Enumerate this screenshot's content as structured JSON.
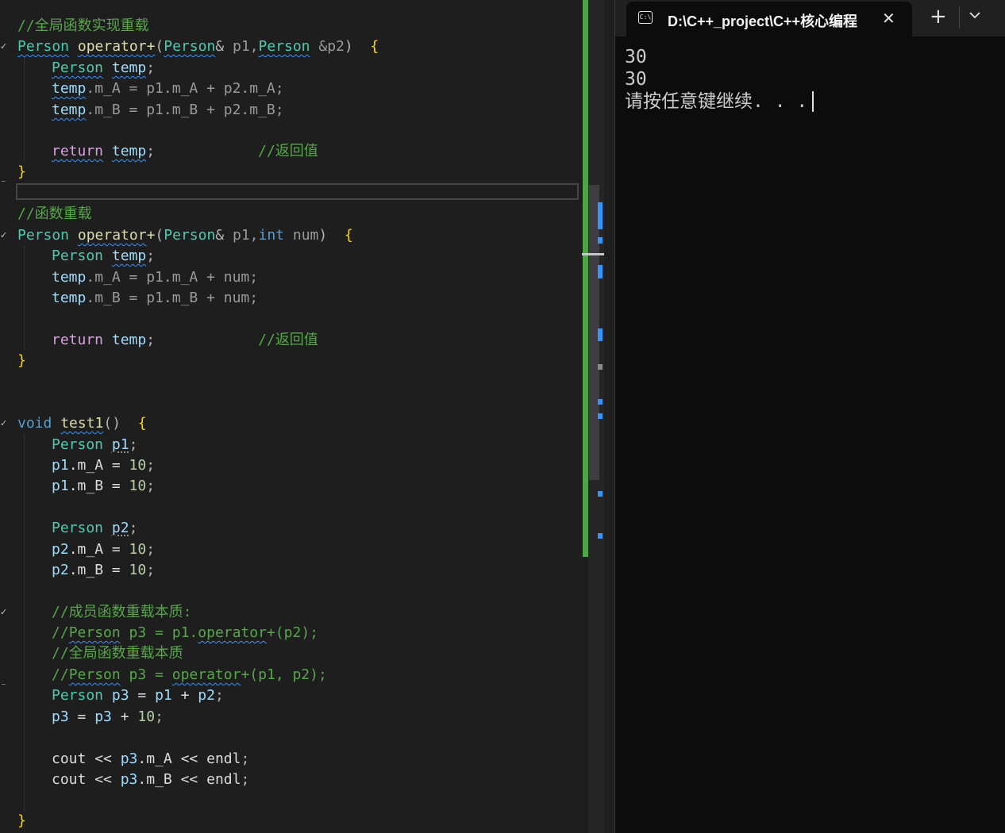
{
  "editor": {
    "lines": [
      {
        "t": 20,
        "i": 0,
        "toks": [
          [
            "//全局函数实现重载",
            "comment"
          ]
        ]
      },
      {
        "t": 46,
        "i": 0,
        "toks": [
          [
            "Person",
            "type",
            "sq"
          ],
          [
            " ",
            "text"
          ],
          [
            "operator+",
            "func",
            "sq"
          ],
          [
            "(",
            "punct"
          ],
          [
            "Person",
            "type",
            "sq"
          ],
          [
            "&",
            "punct"
          ],
          [
            " p1,",
            "param"
          ],
          [
            "Person",
            "type",
            "sq"
          ],
          [
            " &p2",
            "param"
          ],
          [
            ")",
            "punct"
          ],
          [
            "  ",
            "text"
          ],
          [
            "{",
            "brace1"
          ]
        ]
      },
      {
        "t": 73,
        "i": 1,
        "toks": [
          [
            "Person",
            "type",
            "sq"
          ],
          [
            " ",
            "text"
          ],
          [
            "temp",
            "ident",
            "sq"
          ],
          [
            ";",
            "punct"
          ]
        ]
      },
      {
        "t": 99,
        "i": 1,
        "toks": [
          [
            "temp",
            "ident",
            "sq"
          ],
          [
            ".m_A = p1.m_A + p2.m_A;",
            "param"
          ]
        ]
      },
      {
        "t": 126,
        "i": 1,
        "toks": [
          [
            "temp",
            "ident",
            "sq"
          ],
          [
            ".m_B = p1.m_B + p2.m_B;",
            "param"
          ]
        ]
      },
      {
        "t": 178,
        "i": 1,
        "toks": [
          [
            "return",
            "ctl",
            "sq"
          ],
          [
            " ",
            "text"
          ],
          [
            "temp",
            "ident",
            "sq"
          ],
          [
            ";",
            "punct"
          ],
          [
            "            ",
            "text"
          ],
          [
            "//返回值",
            "comment"
          ]
        ]
      },
      {
        "t": 204,
        "i": 0,
        "toks": [
          [
            "}",
            "brace1"
          ]
        ]
      },
      {
        "t": 257,
        "i": 0,
        "toks": [
          [
            "//函数重载",
            "comment"
          ]
        ]
      },
      {
        "t": 284,
        "i": 0,
        "toks": [
          [
            "Person",
            "type"
          ],
          [
            " ",
            "text"
          ],
          [
            "operator",
            "func",
            "sq"
          ],
          [
            "+",
            "func"
          ],
          [
            "(",
            "punct"
          ],
          [
            "Person",
            "type"
          ],
          [
            "&",
            "punct"
          ],
          [
            " p1,",
            "param"
          ],
          [
            "int",
            "kw"
          ],
          [
            " num",
            "param"
          ],
          [
            ")",
            "punct"
          ],
          [
            "  ",
            "text"
          ],
          [
            "{",
            "brace1"
          ]
        ]
      },
      {
        "t": 310,
        "i": 1,
        "toks": [
          [
            "Person",
            "type"
          ],
          [
            " ",
            "text"
          ],
          [
            "temp",
            "ident",
            "sq"
          ],
          [
            ";",
            "punct"
          ]
        ]
      },
      {
        "t": 337,
        "i": 1,
        "toks": [
          [
            "temp",
            "ident"
          ],
          [
            ".m_A = p1.m_A + num;",
            "param"
          ]
        ]
      },
      {
        "t": 363,
        "i": 1,
        "toks": [
          [
            "temp",
            "ident"
          ],
          [
            ".m_B = p1.m_B + num;",
            "param"
          ]
        ]
      },
      {
        "t": 416,
        "i": 1,
        "toks": [
          [
            "return",
            "ctl"
          ],
          [
            " ",
            "text"
          ],
          [
            "temp",
            "ident"
          ],
          [
            ";",
            "punct"
          ],
          [
            "            ",
            "text"
          ],
          [
            "//返回值",
            "comment"
          ]
        ]
      },
      {
        "t": 442,
        "i": 0,
        "toks": [
          [
            "}",
            "brace1"
          ]
        ]
      },
      {
        "t": 521,
        "i": 0,
        "toks": [
          [
            "void",
            "kw"
          ],
          [
            " ",
            "text"
          ],
          [
            "test1",
            "func",
            "sq"
          ],
          [
            "()",
            "punct"
          ],
          [
            "  ",
            "text"
          ],
          [
            "{",
            "brace1"
          ]
        ]
      },
      {
        "t": 548,
        "i": 1,
        "toks": [
          [
            "Person",
            "type"
          ],
          [
            " ",
            "text"
          ],
          [
            "p1",
            "ident",
            "dot"
          ],
          [
            ";",
            "punct"
          ]
        ]
      },
      {
        "t": 574,
        "i": 1,
        "toks": [
          [
            "p1",
            "ident"
          ],
          [
            ".m_A = ",
            "text"
          ],
          [
            "10",
            "num"
          ],
          [
            ";",
            "punct"
          ]
        ]
      },
      {
        "t": 600,
        "i": 1,
        "toks": [
          [
            "p1",
            "ident"
          ],
          [
            ".m_B = ",
            "text"
          ],
          [
            "10",
            "num"
          ],
          [
            ";",
            "punct"
          ]
        ]
      },
      {
        "t": 653,
        "i": 1,
        "toks": [
          [
            "Person",
            "type"
          ],
          [
            " ",
            "text"
          ],
          [
            "p2",
            "ident",
            "dot"
          ],
          [
            ";",
            "punct"
          ]
        ]
      },
      {
        "t": 680,
        "i": 1,
        "toks": [
          [
            "p2",
            "ident"
          ],
          [
            ".m_A = ",
            "text"
          ],
          [
            "10",
            "num"
          ],
          [
            ";",
            "punct"
          ]
        ]
      },
      {
        "t": 706,
        "i": 1,
        "toks": [
          [
            "p2",
            "ident"
          ],
          [
            ".m_B = ",
            "text"
          ],
          [
            "10",
            "num"
          ],
          [
            ";",
            "punct"
          ]
        ]
      },
      {
        "t": 759,
        "i": 1,
        "toks": [
          [
            "//成员函数重载本质:",
            "comment"
          ]
        ]
      },
      {
        "t": 785,
        "i": 1,
        "toks": [
          [
            "//",
            "comment"
          ],
          [
            "Person",
            "comment",
            "sq"
          ],
          [
            " p3 = p1.",
            "comment"
          ],
          [
            "operator",
            "comment",
            "sq"
          ],
          [
            "+(p2);",
            "comment"
          ]
        ]
      },
      {
        "t": 811,
        "i": 1,
        "toks": [
          [
            "//全局函数重载本质",
            "comment"
          ]
        ]
      },
      {
        "t": 838,
        "i": 1,
        "toks": [
          [
            "//",
            "comment"
          ],
          [
            "Person",
            "comment",
            "sq"
          ],
          [
            " p3 = ",
            "comment"
          ],
          [
            "operator",
            "comment",
            "sq"
          ],
          [
            "+(p1, p2);",
            "comment"
          ]
        ]
      },
      {
        "t": 864,
        "i": 1,
        "toks": [
          [
            "Person",
            "type"
          ],
          [
            " ",
            "text"
          ],
          [
            "p3",
            "ident"
          ],
          [
            " = ",
            "text"
          ],
          [
            "p1",
            "ident"
          ],
          [
            " + ",
            "text"
          ],
          [
            "p2",
            "ident"
          ],
          [
            ";",
            "punct"
          ]
        ]
      },
      {
        "t": 891,
        "i": 1,
        "toks": [
          [
            "p3",
            "ident"
          ],
          [
            " = ",
            "text"
          ],
          [
            "p3",
            "ident"
          ],
          [
            " + ",
            "text"
          ],
          [
            "10",
            "num"
          ],
          [
            ";",
            "punct"
          ]
        ]
      },
      {
        "t": 944,
        "i": 1,
        "toks": [
          [
            "cout",
            "text"
          ],
          [
            " << ",
            "text"
          ],
          [
            "p3",
            "ident"
          ],
          [
            ".m_A << ",
            "text"
          ],
          [
            "endl",
            "text"
          ],
          [
            ";",
            "punct"
          ]
        ]
      },
      {
        "t": 970,
        "i": 1,
        "toks": [
          [
            "cout",
            "text"
          ],
          [
            " << ",
            "text"
          ],
          [
            "p3",
            "ident"
          ],
          [
            ".m_B << ",
            "text"
          ],
          [
            "endl",
            "text"
          ],
          [
            ";",
            "punct"
          ]
        ]
      },
      {
        "t": 1022,
        "i": 0,
        "toks": [
          [
            "}",
            "brace1"
          ]
        ]
      }
    ]
  },
  "terminal": {
    "tab_icon_label": "C:\\",
    "tab_title": "D:\\C++_project\\C++核心编程",
    "close_icon": "close-icon",
    "new_tab_icon": "plus-icon",
    "dropdown_icon": "chevron-down-icon",
    "output": [
      "30",
      "30",
      "请按任意键继续. . ."
    ]
  },
  "colors": {
    "editor_bg": "#1e1e1e",
    "terminal_bg": "#0c0c0c",
    "change_bar": "#4ca646",
    "comment": "#57a64a",
    "type": "#4ec9b0",
    "keyword": "#569cd6"
  }
}
